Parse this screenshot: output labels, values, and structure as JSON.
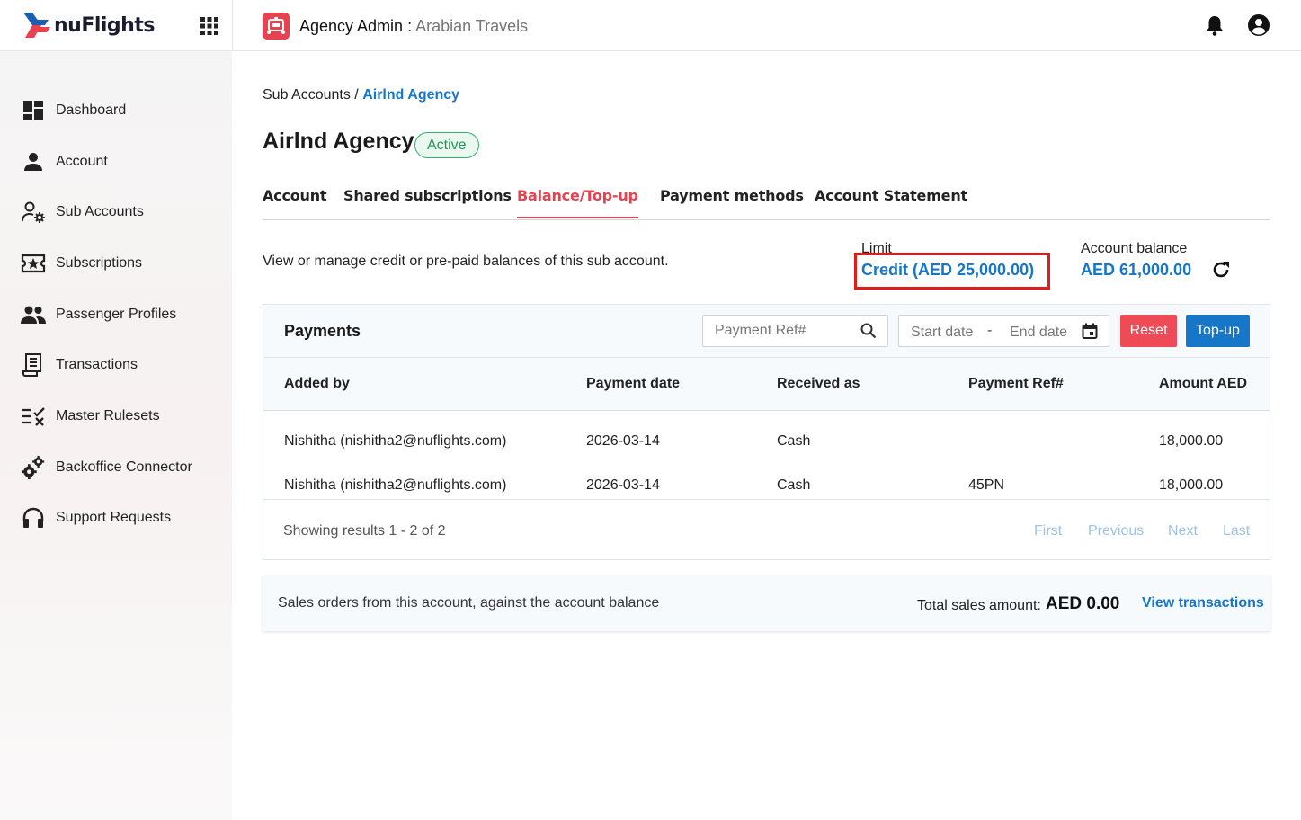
{
  "brand": {
    "logo_text": "nuFlights"
  },
  "header": {
    "title": "Agency Admin",
    "separator": " : ",
    "agency_name": "Arabian Travels"
  },
  "sidebar": {
    "items": [
      {
        "label": "Dashboard",
        "icon": "dashboard-icon"
      },
      {
        "label": "Account",
        "icon": "person-icon"
      },
      {
        "label": "Sub Accounts",
        "icon": "sub-accounts-icon"
      },
      {
        "label": "Subscriptions",
        "icon": "subscriptions-icon"
      },
      {
        "label": "Passenger Profiles",
        "icon": "people-icon"
      },
      {
        "label": "Transactions",
        "icon": "receipt-icon"
      },
      {
        "label": "Master Rulesets",
        "icon": "rules-icon"
      },
      {
        "label": "Backoffice Connector",
        "icon": "gears-icon"
      },
      {
        "label": "Support Requests",
        "icon": "headset-icon"
      }
    ]
  },
  "breadcrumb": {
    "parent": "Sub Accounts",
    "separator": " / ",
    "current": "Airlnd Agency"
  },
  "page": {
    "title": "Airlnd Agency",
    "status": "Active"
  },
  "tabs": [
    {
      "label": "Account",
      "active": false
    },
    {
      "label": "Shared subscriptions",
      "active": false
    },
    {
      "label": "Balance/Top-up",
      "active": true
    },
    {
      "label": "Payment methods",
      "active": false
    },
    {
      "label": "Account Statement",
      "active": false
    }
  ],
  "balance": {
    "description": "View or manage credit or pre-paid balances of this sub account.",
    "limit_label": "Limit",
    "limit_value": "Credit (AED 25,000.00)",
    "account_balance_label": "Account balance",
    "account_balance_value": "AED 61,000.00"
  },
  "payments": {
    "title": "Payments",
    "search_placeholder": "Payment Ref#",
    "start_date_placeholder": "Start date",
    "date_separator": "-",
    "end_date_placeholder": "End date",
    "reset_label": "Reset",
    "topup_label": "Top-up",
    "columns": [
      "Added by",
      "Payment date",
      "Received as",
      "Payment Ref#",
      "Amount AED"
    ],
    "rows": [
      {
        "added_by": "Nishitha (nishitha2@nuflights.com)",
        "date": "2026-03-14",
        "received_as": "Cash",
        "ref": "",
        "amount": "18,000.00"
      },
      {
        "added_by": "Nishitha (nishitha2@nuflights.com)",
        "date": "2026-03-14",
        "received_as": "Cash",
        "ref": "45PN",
        "amount": "18,000.00"
      }
    ],
    "showing": "Showing results 1 - 2 of 2",
    "pager": {
      "first": "First",
      "previous": "Previous",
      "next": "Next",
      "last": "Last"
    }
  },
  "sales": {
    "description": "Sales orders from this account, against the account balance",
    "total_label": "Total sales amount:",
    "total_value": "AED 0.00",
    "view_link": "View transactions"
  },
  "colors": {
    "brand_red": "#e8414f",
    "link_blue": "#1677c9",
    "active_green": "#1f9a56",
    "highlight_red": "#e21b1b"
  }
}
